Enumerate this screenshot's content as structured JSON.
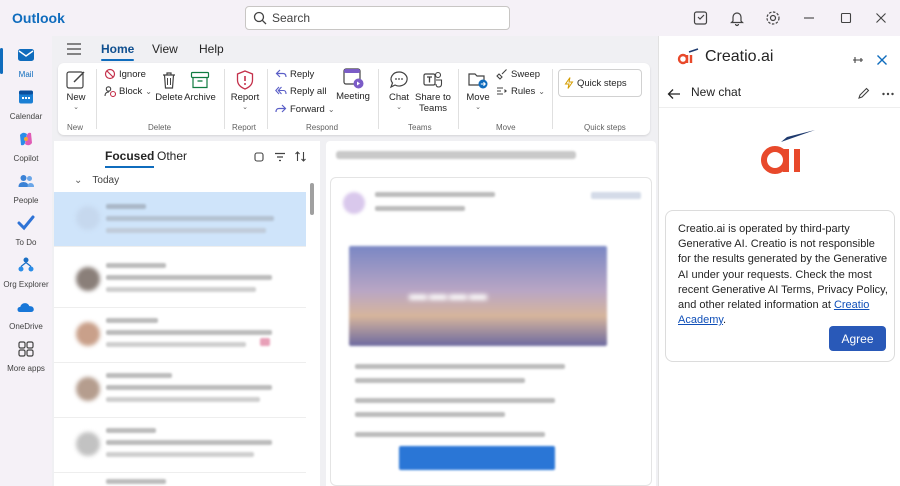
{
  "app": {
    "title": "Outlook"
  },
  "search": {
    "placeholder": "Search"
  },
  "titlebar_icons": [
    "note-icon",
    "bell-icon",
    "gear-icon",
    "minimize-icon",
    "maximize-icon",
    "close-icon"
  ],
  "rail": [
    {
      "label": "Mail",
      "icon": "mail-icon",
      "active": true
    },
    {
      "label": "Calendar",
      "icon": "calendar-icon"
    },
    {
      "label": "Copilot",
      "icon": "copilot-icon"
    },
    {
      "label": "People",
      "icon": "people-icon"
    },
    {
      "label": "To Do",
      "icon": "todo-icon"
    },
    {
      "label": "Org Explorer",
      "icon": "org-explorer-icon"
    },
    {
      "label": "OneDrive",
      "icon": "onedrive-icon"
    },
    {
      "label": "More apps",
      "icon": "more-apps-icon"
    }
  ],
  "ribbon_tabs": [
    "Home",
    "View",
    "Help"
  ],
  "ribbon": {
    "new": "New",
    "ignore": "Ignore",
    "block": "Block",
    "delete": "Delete",
    "archive": "Archive",
    "report": "Report",
    "reply": "Reply",
    "reply_all": "Reply all",
    "forward": "Forward",
    "meeting": "Meeting",
    "chat": "Chat",
    "share_to_teams": [
      "Share to",
      "Teams"
    ],
    "move": "Move",
    "sweep": "Sweep",
    "rules": "Rules",
    "quick_steps": "Quick steps",
    "groups": [
      "New",
      "Delete",
      "Report",
      "Respond",
      "Teams",
      "Move",
      "Quick steps"
    ]
  },
  "mail_list": {
    "tabs": [
      "Focused",
      "Other"
    ],
    "group_label": "Today"
  },
  "panel": {
    "brand": "Creatio.ai",
    "new_chat": "New chat",
    "notice_before": "Creatio.ai is operated by third-party Generative AI. Creatio is not responsible for the results generated by the Generative AI under your requests. Check the most recent Generative AI Terms, Privacy Policy, and other related information at ",
    "notice_link": "Creatio Academy",
    "notice_after": ".",
    "agree": "Agree"
  },
  "colors": {
    "accent": "#0f6cbd",
    "creatio_red": "#e8492b",
    "creatio_navy": "#1e3a6e",
    "agree_button": "#2959b8",
    "selected_row": "#cfe4fa"
  }
}
